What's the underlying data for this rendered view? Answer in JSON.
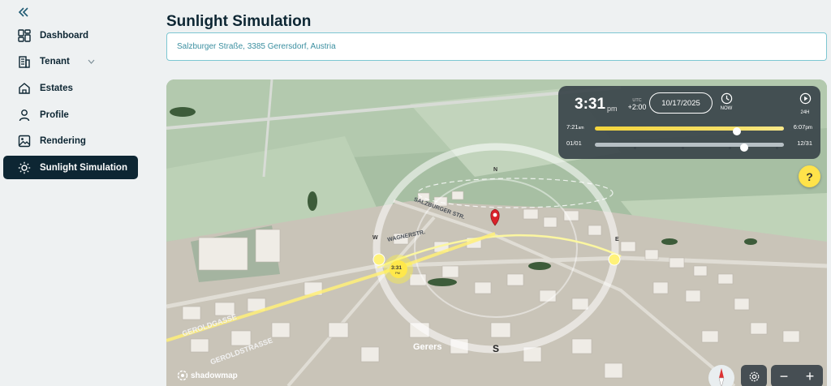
{
  "sidebar": {
    "collapse_icon": "double-chevron-left-icon",
    "items": [
      {
        "label": "Dashboard",
        "icon": "dashboard-grid-icon"
      },
      {
        "label": "Tenant",
        "icon": "building-icon"
      },
      {
        "label": "Estates",
        "icon": "house-icon"
      },
      {
        "label": "Profile",
        "icon": "user-icon"
      },
      {
        "label": "Rendering",
        "icon": "image-icon"
      },
      {
        "label": "Sunlight Simulation",
        "icon": "sun-icon",
        "active": true
      }
    ]
  },
  "header": {
    "title": "Sunlight Simulation",
    "address": "Salzburger Straße, 3385 Gerersdorf, Austria"
  },
  "panel": {
    "time": "3:31",
    "ampm": "pm",
    "utc_label": "UTC",
    "utc_offset": "+2:00",
    "date": "10/17/2025",
    "now_label": "NOW",
    "h24_label": "24H",
    "sunrise_time": "7:21",
    "sunrise_ampm": "am",
    "sunset_time": "6:07",
    "sunset_ampm": "pm",
    "day_progress": 0.75,
    "year_start": "01/01",
    "year_end": "12/31",
    "year_progress": 0.79
  },
  "map": {
    "street_label_1": "SALZBURGER STR.",
    "street_label_2": "WAGNERSTR.",
    "street_label_3": "GEROLDGASSE",
    "street_label_4": "GEROLDSTRASSE",
    "place_label": "Gerers",
    "sun_time": "3:31",
    "sun_ampm": "PM",
    "compass_n": "N",
    "compass_s": "S",
    "compass_e": "E",
    "compass_w": "W",
    "brand": "shadowmap",
    "help": "?",
    "zoom_out": "−",
    "zoom_in": "+"
  },
  "colors": {
    "accent": "#0d2633",
    "sun_yellow": "#ffe34a",
    "address_text": "#3b8fa0"
  }
}
